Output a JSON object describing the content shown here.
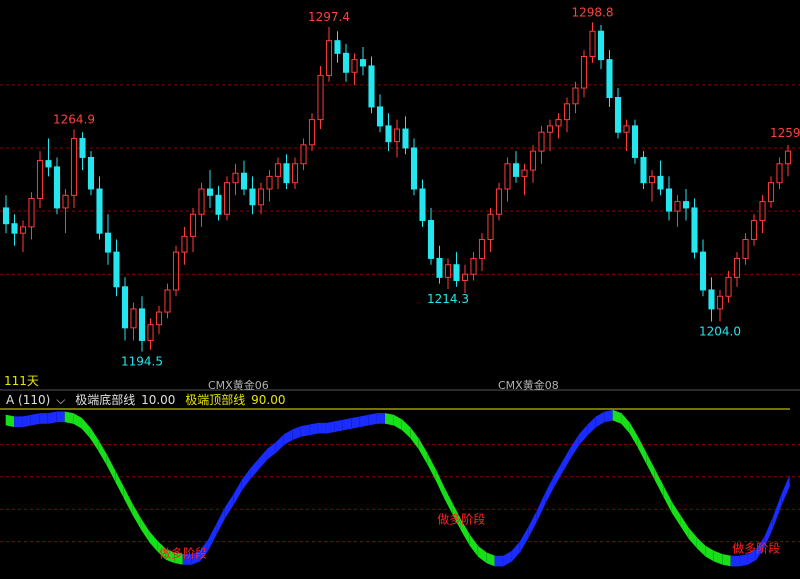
{
  "chart_data": [
    {
      "type": "candlestick",
      "title": "",
      "ylim": [
        1188,
        1304
      ],
      "colors": {
        "up": "#ff3a3a",
        "down": "#25e6ee",
        "grid": "#8b0000"
      },
      "annotations": {
        "highs": [
          "1264.9",
          "1297.4",
          "1298.8",
          "1259"
        ],
        "lows": [
          "1194.5",
          "1214.3",
          "1204.0"
        ]
      },
      "period_label": "111天",
      "contract_labels": [
        "CMX黄金06",
        "CMX黄金08"
      ],
      "candles": [
        [
          1240,
          1244,
          1232,
          1235
        ],
        [
          1235,
          1238,
          1228,
          1232
        ],
        [
          1232,
          1236,
          1226,
          1234
        ],
        [
          1234,
          1245,
          1230,
          1243
        ],
        [
          1243,
          1258,
          1240,
          1255
        ],
        [
          1255,
          1262,
          1250,
          1253
        ],
        [
          1253,
          1256,
          1238,
          1240
        ],
        [
          1240,
          1246,
          1232,
          1244
        ],
        [
          1244,
          1264.9,
          1240,
          1262
        ],
        [
          1262,
          1264,
          1252,
          1256
        ],
        [
          1256,
          1258,
          1244,
          1246
        ],
        [
          1246,
          1250,
          1230,
          1232
        ],
        [
          1232,
          1238,
          1222,
          1226
        ],
        [
          1226,
          1230,
          1212,
          1215
        ],
        [
          1215,
          1218,
          1198,
          1202
        ],
        [
          1202,
          1210,
          1198,
          1208
        ],
        [
          1208,
          1212,
          1194.5,
          1198
        ],
        [
          1198,
          1205,
          1195,
          1203
        ],
        [
          1203,
          1209,
          1200,
          1207
        ],
        [
          1207,
          1216,
          1205,
          1214
        ],
        [
          1214,
          1228,
          1212,
          1226
        ],
        [
          1226,
          1234,
          1222,
          1231
        ],
        [
          1231,
          1240,
          1226,
          1238
        ],
        [
          1238,
          1248,
          1234,
          1246
        ],
        [
          1246,
          1252,
          1240,
          1244
        ],
        [
          1244,
          1247,
          1236,
          1238
        ],
        [
          1238,
          1250,
          1236,
          1248
        ],
        [
          1248,
          1254,
          1244,
          1251
        ],
        [
          1251,
          1255,
          1244,
          1246
        ],
        [
          1246,
          1250,
          1238,
          1241
        ],
        [
          1241,
          1248,
          1238,
          1246
        ],
        [
          1246,
          1252,
          1242,
          1250
        ],
        [
          1250,
          1256,
          1246,
          1254
        ],
        [
          1254,
          1257,
          1246,
          1248
        ],
        [
          1248,
          1256,
          1246,
          1254
        ],
        [
          1254,
          1262,
          1252,
          1260
        ],
        [
          1260,
          1270,
          1258,
          1268
        ],
        [
          1268,
          1285,
          1265,
          1282
        ],
        [
          1282,
          1297.4,
          1280,
          1293
        ],
        [
          1293,
          1296,
          1286,
          1289
        ],
        [
          1289,
          1292,
          1280,
          1283
        ],
        [
          1283,
          1289,
          1279,
          1287
        ],
        [
          1287,
          1291,
          1282,
          1285
        ],
        [
          1285,
          1288,
          1270,
          1272
        ],
        [
          1272,
          1276,
          1264,
          1266
        ],
        [
          1266,
          1270,
          1258,
          1261
        ],
        [
          1261,
          1268,
          1256,
          1265
        ],
        [
          1265,
          1269,
          1257,
          1259
        ],
        [
          1259,
          1262,
          1244,
          1246
        ],
        [
          1246,
          1249,
          1234,
          1236
        ],
        [
          1236,
          1240,
          1222,
          1224
        ],
        [
          1224,
          1228,
          1216,
          1218
        ],
        [
          1218,
          1224,
          1214.3,
          1222
        ],
        [
          1222,
          1226,
          1215,
          1217
        ],
        [
          1217,
          1222,
          1213,
          1219
        ],
        [
          1219,
          1226,
          1217,
          1224
        ],
        [
          1224,
          1232,
          1220,
          1230
        ],
        [
          1230,
          1240,
          1226,
          1238
        ],
        [
          1238,
          1248,
          1236,
          1246
        ],
        [
          1246,
          1256,
          1242,
          1254
        ],
        [
          1254,
          1258,
          1248,
          1250
        ],
        [
          1250,
          1254,
          1244,
          1252
        ],
        [
          1252,
          1260,
          1248,
          1258
        ],
        [
          1258,
          1266,
          1254,
          1264
        ],
        [
          1264,
          1268,
          1258,
          1266
        ],
        [
          1266,
          1270,
          1262,
          1268
        ],
        [
          1268,
          1275,
          1264,
          1273
        ],
        [
          1273,
          1280,
          1270,
          1278
        ],
        [
          1278,
          1290,
          1275,
          1288
        ],
        [
          1288,
          1298.8,
          1286,
          1296
        ],
        [
          1296,
          1298,
          1284,
          1287
        ],
        [
          1287,
          1290,
          1272,
          1275
        ],
        [
          1275,
          1278,
          1262,
          1264
        ],
        [
          1264,
          1268,
          1258,
          1266
        ],
        [
          1266,
          1268,
          1254,
          1256
        ],
        [
          1256,
          1258,
          1246,
          1248
        ],
        [
          1248,
          1252,
          1242,
          1250
        ],
        [
          1250,
          1255,
          1244,
          1246
        ],
        [
          1246,
          1250,
          1236,
          1239
        ],
        [
          1239,
          1244,
          1234,
          1242
        ],
        [
          1242,
          1246,
          1236,
          1240
        ],
        [
          1240,
          1243,
          1224,
          1226
        ],
        [
          1226,
          1230,
          1212,
          1214
        ],
        [
          1214,
          1218,
          1204.0,
          1208
        ],
        [
          1208,
          1214,
          1204,
          1212
        ],
        [
          1212,
          1220,
          1210,
          1218
        ],
        [
          1218,
          1226,
          1215,
          1224
        ],
        [
          1224,
          1232,
          1222,
          1230
        ],
        [
          1230,
          1238,
          1228,
          1236
        ],
        [
          1236,
          1244,
          1232,
          1242
        ],
        [
          1242,
          1250,
          1240,
          1248
        ],
        [
          1248,
          1256,
          1246,
          1254
        ],
        [
          1254,
          1260,
          1250,
          1258
        ]
      ]
    },
    {
      "type": "area",
      "indicator": "A (110)",
      "legend": [
        {
          "name": "极端底部线",
          "value": "10.00",
          "color": "#e0e0e0"
        },
        {
          "name": "极端顶部线",
          "value": "90.00",
          "color": "#e8e800"
        }
      ],
      "ylim": [
        0,
        100
      ],
      "gridlines": [
        20,
        40,
        60,
        80
      ],
      "colors": {
        "rising": "#1a2cff",
        "falling": "#18e018"
      },
      "stage_label": "做多阶段",
      "stage_positions": [
        21,
        54,
        89
      ],
      "values": [
        95,
        94,
        94,
        95,
        96,
        96,
        97,
        97,
        96,
        93,
        87,
        79,
        70,
        60,
        50,
        40,
        31,
        23,
        17,
        12,
        10,
        9,
        9,
        11,
        18,
        28,
        38,
        46,
        55,
        62,
        68,
        74,
        78,
        83,
        86,
        88,
        89,
        90,
        90,
        91,
        92,
        93,
        94,
        95,
        96,
        96,
        95,
        92,
        87,
        80,
        71,
        61,
        50,
        40,
        30,
        21,
        14,
        10,
        8,
        8,
        11,
        17,
        26,
        36,
        47,
        57,
        66,
        75,
        83,
        89,
        94,
        97,
        98,
        96,
        90,
        81,
        71,
        61,
        51,
        41,
        33,
        25,
        19,
        14,
        11,
        9,
        8,
        8,
        9,
        12,
        20,
        32,
        46,
        58
      ]
    }
  ]
}
